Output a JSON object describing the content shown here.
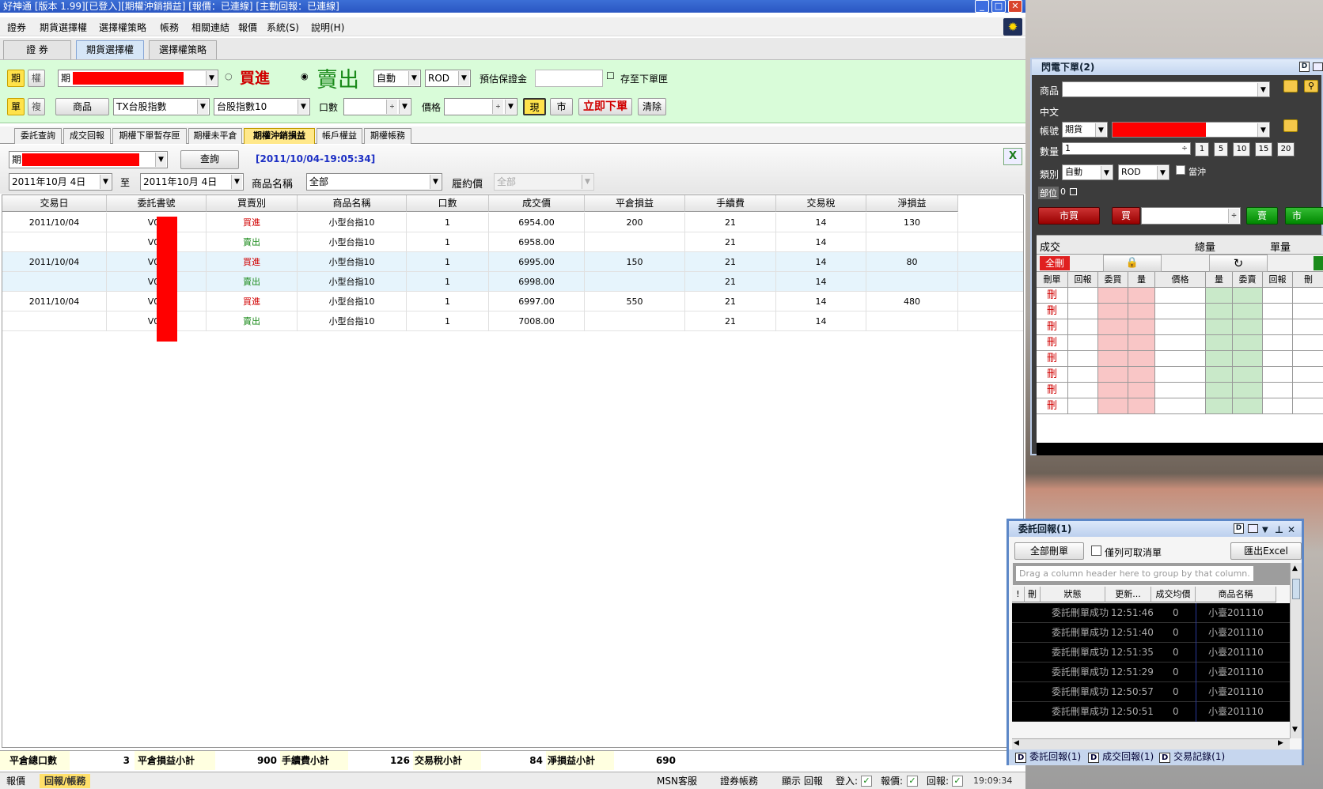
{
  "window": {
    "title": "好神通 [版本 1.99][已登入][期權沖銷損益] [報價：已連線] [主動回報：已連線]",
    "min": "_",
    "max": "□",
    "close": "✕"
  },
  "menu": [
    "證券",
    "期貨選擇權",
    "選擇權策略",
    "帳務",
    "相關連結",
    "報價",
    "系統(S)",
    "說明(H)"
  ],
  "top_tabs": [
    "證 券",
    "期貨選擇權",
    "選擇權策略"
  ],
  "order": {
    "type_btn_futures": "期",
    "type_btn_options": "權",
    "single_btn": "單",
    "complex_btn": "複",
    "account_prefix": "期",
    "buy_label": "買進",
    "sell_label": "賣出",
    "auto": "自動",
    "rod": "ROD",
    "margin_label": "預估保證金",
    "save_label": "存至下單匣",
    "product_btn": "商品",
    "product_select": "TX台股指數",
    "contract_select": "台股指數10",
    "qty_label": "口數",
    "price_label": "價格",
    "now_btn": "現",
    "market_btn": "市",
    "place_order_btn": "立即下單",
    "clear_btn": "清除"
  },
  "sub_tabs": [
    "委託查詢",
    "成交回報",
    "期權下單暫存匣",
    "期權未平倉",
    "期權沖銷損益",
    "帳戶權益",
    "期權帳務"
  ],
  "query": {
    "account_prefix": "期",
    "query_btn": "查詢",
    "timestamp": "[2011/10/04-19:05:34]",
    "date_from": "2011年10月 4日",
    "to_label": "至",
    "date_to": "2011年10月 4日",
    "product_name_label": "商品名稱",
    "product_name_value": "全部",
    "strike_label": "履約價",
    "strike_value": "全部"
  },
  "table": {
    "columns": [
      "交易日",
      "委託書號",
      "買賣別",
      "商品名稱",
      "口數",
      "成交價",
      "平倉損益",
      "手續費",
      "交易稅",
      "淨損益"
    ],
    "rows": [
      [
        "2011/10/04",
        "V00",
        "買進",
        "小型台指10",
        "1",
        "6954.00",
        "200",
        "21",
        "14",
        "130"
      ],
      [
        "",
        "V00",
        "賣出",
        "小型台指10",
        "1",
        "6958.00",
        "",
        "21",
        "14",
        ""
      ],
      [
        "2011/10/04",
        "V00",
        "買進",
        "小型台指10",
        "1",
        "6995.00",
        "150",
        "21",
        "14",
        "80"
      ],
      [
        "",
        "V00",
        "賣出",
        "小型台指10",
        "1",
        "6998.00",
        "",
        "21",
        "14",
        ""
      ],
      [
        "2011/10/04",
        "V00",
        "買進",
        "小型台指10",
        "1",
        "6997.00",
        "550",
        "21",
        "14",
        "480"
      ],
      [
        "",
        "V00",
        "賣出",
        "小型台指10",
        "1",
        "7008.00",
        "",
        "21",
        "14",
        ""
      ]
    ]
  },
  "summary": {
    "total_qty_label": "平倉總口數",
    "total_qty": "3",
    "pnl_label": "平倉損益小計",
    "pnl": "900",
    "fee_label": "手續費小計",
    "fee": "126",
    "tax_label": "交易稅小計",
    "tax": "84",
    "net_label": "淨損益小計",
    "net": "690"
  },
  "statusbar": {
    "quote_tab": "報價",
    "report_tab": "回報/帳務",
    "msn": "MSN客服",
    "securities": "證券帳務",
    "show_report": "顯示 回報",
    "login": "登入:",
    "quote": "報價:",
    "reply": "回報:",
    "time": "19:09:34"
  },
  "flash": {
    "title": "閃電下單(2)",
    "product_label": "商品",
    "chinese_label": "中文",
    "account_label": "帳號",
    "account_type": "期貨",
    "qty_label": "數量",
    "qty_value": "1",
    "qty_presets": [
      "1",
      "5",
      "10",
      "15",
      "20"
    ],
    "kind_label": "類別",
    "kind_value": "自動",
    "rod": "ROD",
    "daytrade_label": "當沖",
    "position_label": "部位",
    "position_value": "0",
    "market_buy": "市買",
    "buy": "買",
    "sell": "賣",
    "market_sell": "市",
    "filled_label": "成交",
    "total_label": "總量",
    "single_label": "單量",
    "delete_all": "全刪",
    "grid_headers": [
      "刪單",
      "回報",
      "委買",
      "量",
      "價格",
      "量",
      "委賣",
      "回報",
      "刪"
    ],
    "delete_symbol": "刪"
  },
  "report": {
    "title": "委託回報(1)",
    "delete_all_btn": "全部刪單",
    "only_cancelable": "僅列可取消單",
    "export_btn": "匯出Excel",
    "group_hint": "Drag a column header here to group by that column.",
    "columns": [
      "!",
      "刪",
      "狀態",
      "更新...",
      "成交均價",
      "商品名稱"
    ],
    "rows": [
      [
        "委託刪單成功",
        "12:51:46",
        "0",
        "小臺201110"
      ],
      [
        "委託刪單成功",
        "12:51:40",
        "0",
        "小臺201110"
      ],
      [
        "委託刪單成功",
        "12:51:35",
        "0",
        "小臺201110"
      ],
      [
        "委託刪單成功",
        "12:51:29",
        "0",
        "小臺201110"
      ],
      [
        "委託刪單成功",
        "12:50:57",
        "0",
        "小臺201110"
      ],
      [
        "委託刪單成功",
        "12:50:51",
        "0",
        "小臺201110"
      ]
    ],
    "tabs": [
      "委託回報(1)",
      "成交回報(1)",
      "交易記錄(1)"
    ]
  },
  "colors": {
    "buy": "#d00000",
    "sell": "#1a8a1a",
    "accent": "#1c2fc4",
    "redacted": "#ff0000"
  }
}
